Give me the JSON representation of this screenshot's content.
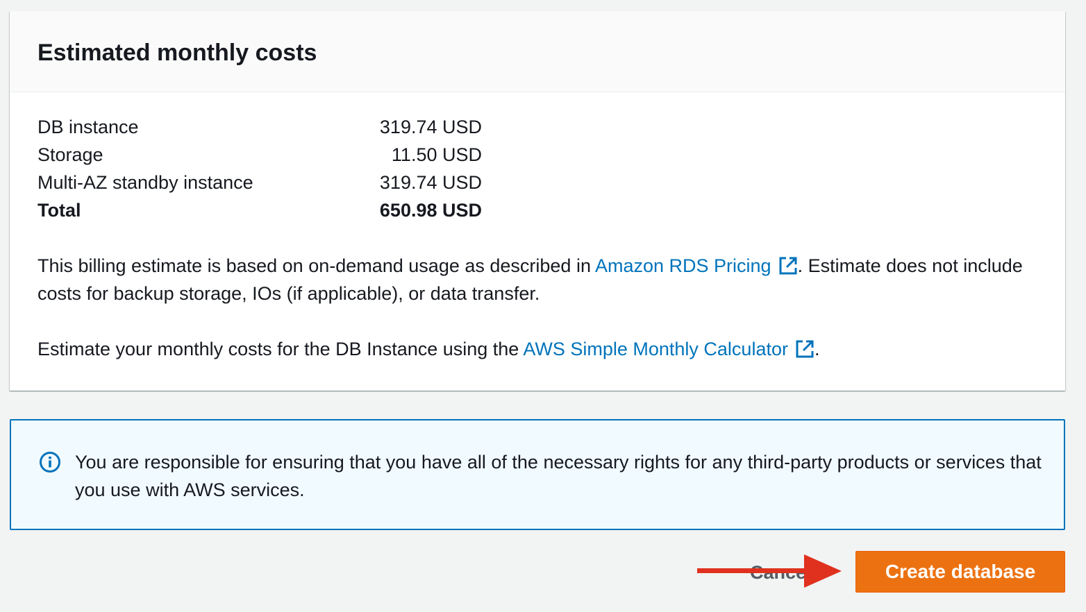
{
  "panel": {
    "title": "Estimated monthly costs",
    "rows": [
      {
        "label": "DB instance",
        "value": "319.74 USD"
      },
      {
        "label": "Storage",
        "value": "11.50 USD"
      },
      {
        "label": "Multi-AZ standby instance",
        "value": "319.74 USD"
      }
    ],
    "total": {
      "label": "Total",
      "value": "650.98 USD"
    },
    "paragraph1": {
      "before": "This billing estimate is based on on-demand usage as described in ",
      "link": "Amazon RDS Pricing",
      "after": ". Estimate does not include costs for backup storage, IOs (if applicable), or data transfer."
    },
    "paragraph2": {
      "before": "Estimate your monthly costs for the DB Instance using the ",
      "link": "AWS Simple Monthly Calculator",
      "after": "."
    }
  },
  "alert": {
    "icon": "info-icon",
    "text": "You are responsible for ensuring that you have all of the necessary rights for any third-party products or services that you use with AWS services."
  },
  "actions": {
    "cancel_label": "Cancel",
    "create_label": "Create database"
  },
  "colors": {
    "link": "#0073bb",
    "primary_button": "#ec7211",
    "alert_border": "#0073bb",
    "alert_background": "#f1faff",
    "annotation_arrow": "#e0311f"
  }
}
